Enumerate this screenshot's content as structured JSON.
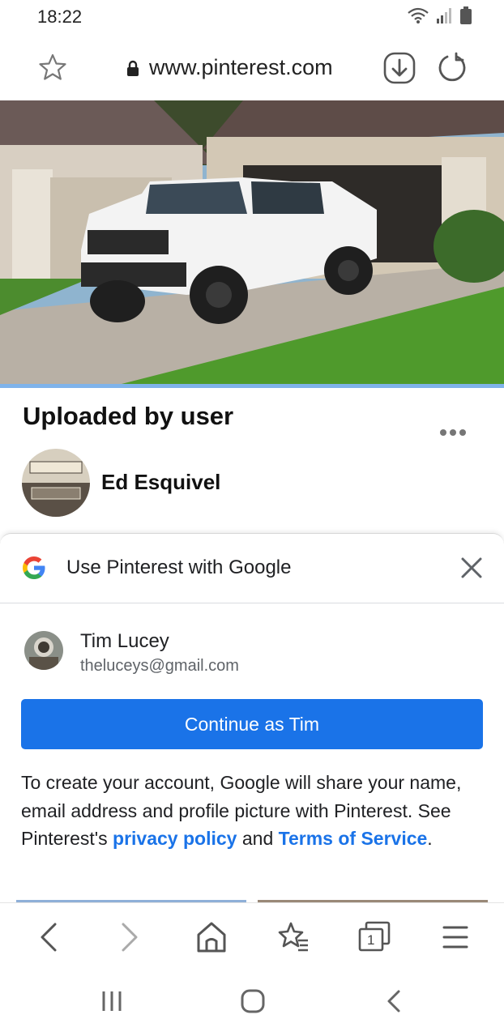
{
  "status_bar": {
    "time": "18:22"
  },
  "browser": {
    "url": "www.pinterest.com",
    "icons": [
      "star-icon",
      "lock-icon",
      "download-icon",
      "reload-icon"
    ]
  },
  "pin": {
    "title": "Uploaded by user",
    "creator_name": "Ed Esquivel"
  },
  "google_sheet": {
    "title": "Use Pinterest with Google",
    "account_name": "Tim Lucey",
    "account_email": "theluceys@gmail.com",
    "continue_label": "Continue as Tim",
    "disclaimer_part1": "To create your account, Google will share your name, email address and profile picture with Pinterest. See Pinterest's ",
    "privacy_link": "privacy policy",
    "disclaimer_and": " and ",
    "terms_link": "Terms of Service",
    "disclaimer_end": "."
  },
  "toolbar": {
    "tab_count": "1"
  },
  "colors": {
    "accent": "#1a73e8",
    "hero_underline": "#7fb3ea"
  }
}
